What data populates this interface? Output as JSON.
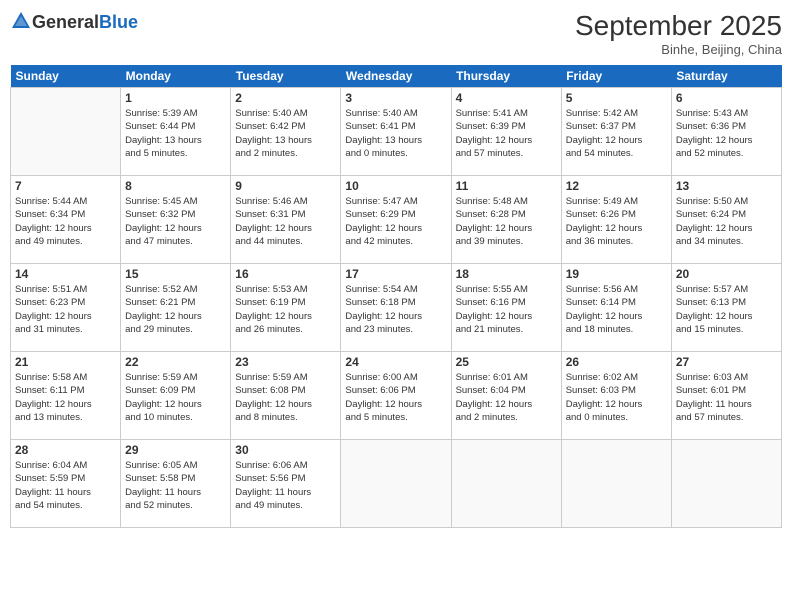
{
  "header": {
    "logo_general": "General",
    "logo_blue": "Blue",
    "title": "September 2025",
    "subtitle": "Binhe, Beijing, China"
  },
  "days_of_week": [
    "Sunday",
    "Monday",
    "Tuesday",
    "Wednesday",
    "Thursday",
    "Friday",
    "Saturday"
  ],
  "weeks": [
    [
      {
        "day": "",
        "info": ""
      },
      {
        "day": "1",
        "info": "Sunrise: 5:39 AM\nSunset: 6:44 PM\nDaylight: 13 hours\nand 5 minutes."
      },
      {
        "day": "2",
        "info": "Sunrise: 5:40 AM\nSunset: 6:42 PM\nDaylight: 13 hours\nand 2 minutes."
      },
      {
        "day": "3",
        "info": "Sunrise: 5:40 AM\nSunset: 6:41 PM\nDaylight: 13 hours\nand 0 minutes."
      },
      {
        "day": "4",
        "info": "Sunrise: 5:41 AM\nSunset: 6:39 PM\nDaylight: 12 hours\nand 57 minutes."
      },
      {
        "day": "5",
        "info": "Sunrise: 5:42 AM\nSunset: 6:37 PM\nDaylight: 12 hours\nand 54 minutes."
      },
      {
        "day": "6",
        "info": "Sunrise: 5:43 AM\nSunset: 6:36 PM\nDaylight: 12 hours\nand 52 minutes."
      }
    ],
    [
      {
        "day": "7",
        "info": "Sunrise: 5:44 AM\nSunset: 6:34 PM\nDaylight: 12 hours\nand 49 minutes."
      },
      {
        "day": "8",
        "info": "Sunrise: 5:45 AM\nSunset: 6:32 PM\nDaylight: 12 hours\nand 47 minutes."
      },
      {
        "day": "9",
        "info": "Sunrise: 5:46 AM\nSunset: 6:31 PM\nDaylight: 12 hours\nand 44 minutes."
      },
      {
        "day": "10",
        "info": "Sunrise: 5:47 AM\nSunset: 6:29 PM\nDaylight: 12 hours\nand 42 minutes."
      },
      {
        "day": "11",
        "info": "Sunrise: 5:48 AM\nSunset: 6:28 PM\nDaylight: 12 hours\nand 39 minutes."
      },
      {
        "day": "12",
        "info": "Sunrise: 5:49 AM\nSunset: 6:26 PM\nDaylight: 12 hours\nand 36 minutes."
      },
      {
        "day": "13",
        "info": "Sunrise: 5:50 AM\nSunset: 6:24 PM\nDaylight: 12 hours\nand 34 minutes."
      }
    ],
    [
      {
        "day": "14",
        "info": "Sunrise: 5:51 AM\nSunset: 6:23 PM\nDaylight: 12 hours\nand 31 minutes."
      },
      {
        "day": "15",
        "info": "Sunrise: 5:52 AM\nSunset: 6:21 PM\nDaylight: 12 hours\nand 29 minutes."
      },
      {
        "day": "16",
        "info": "Sunrise: 5:53 AM\nSunset: 6:19 PM\nDaylight: 12 hours\nand 26 minutes."
      },
      {
        "day": "17",
        "info": "Sunrise: 5:54 AM\nSunset: 6:18 PM\nDaylight: 12 hours\nand 23 minutes."
      },
      {
        "day": "18",
        "info": "Sunrise: 5:55 AM\nSunset: 6:16 PM\nDaylight: 12 hours\nand 21 minutes."
      },
      {
        "day": "19",
        "info": "Sunrise: 5:56 AM\nSunset: 6:14 PM\nDaylight: 12 hours\nand 18 minutes."
      },
      {
        "day": "20",
        "info": "Sunrise: 5:57 AM\nSunset: 6:13 PM\nDaylight: 12 hours\nand 15 minutes."
      }
    ],
    [
      {
        "day": "21",
        "info": "Sunrise: 5:58 AM\nSunset: 6:11 PM\nDaylight: 12 hours\nand 13 minutes."
      },
      {
        "day": "22",
        "info": "Sunrise: 5:59 AM\nSunset: 6:09 PM\nDaylight: 12 hours\nand 10 minutes."
      },
      {
        "day": "23",
        "info": "Sunrise: 5:59 AM\nSunset: 6:08 PM\nDaylight: 12 hours\nand 8 minutes."
      },
      {
        "day": "24",
        "info": "Sunrise: 6:00 AM\nSunset: 6:06 PM\nDaylight: 12 hours\nand 5 minutes."
      },
      {
        "day": "25",
        "info": "Sunrise: 6:01 AM\nSunset: 6:04 PM\nDaylight: 12 hours\nand 2 minutes."
      },
      {
        "day": "26",
        "info": "Sunrise: 6:02 AM\nSunset: 6:03 PM\nDaylight: 12 hours\nand 0 minutes."
      },
      {
        "day": "27",
        "info": "Sunrise: 6:03 AM\nSunset: 6:01 PM\nDaylight: 11 hours\nand 57 minutes."
      }
    ],
    [
      {
        "day": "28",
        "info": "Sunrise: 6:04 AM\nSunset: 5:59 PM\nDaylight: 11 hours\nand 54 minutes."
      },
      {
        "day": "29",
        "info": "Sunrise: 6:05 AM\nSunset: 5:58 PM\nDaylight: 11 hours\nand 52 minutes."
      },
      {
        "day": "30",
        "info": "Sunrise: 6:06 AM\nSunset: 5:56 PM\nDaylight: 11 hours\nand 49 minutes."
      },
      {
        "day": "",
        "info": ""
      },
      {
        "day": "",
        "info": ""
      },
      {
        "day": "",
        "info": ""
      },
      {
        "day": "",
        "info": ""
      }
    ]
  ]
}
